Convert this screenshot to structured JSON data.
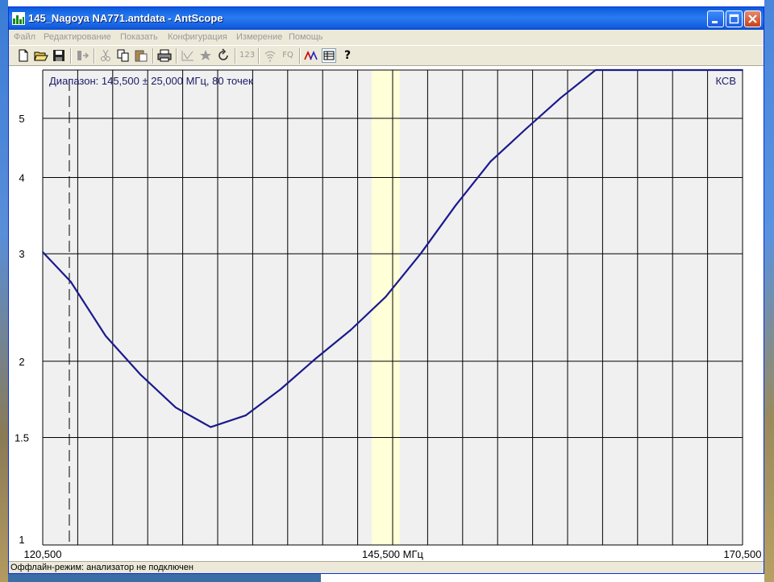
{
  "window": {
    "title": "145_Nagoya NA771.antdata - AntScope"
  },
  "menu": {
    "items": [
      "Файл",
      "Редактирование",
      "Показать",
      "Конфигурация",
      "Измерение",
      "Помощь"
    ]
  },
  "toolbar": {
    "buttons": [
      "new-file-icon",
      "open-folder-icon",
      "save-disk-icon",
      "export-icon",
      "cut-icon",
      "copy-icon",
      "paste-icon",
      "print-icon",
      "graph-icon",
      "marker-icon",
      "refresh-icon",
      "numbers-icon",
      "wireless-icon",
      "fq-icon",
      "curves-icon",
      "table-icon",
      "help-icon"
    ],
    "fq_label": "FQ",
    "numbers_label": "123",
    "help_label": "?"
  },
  "status": {
    "text": "Оффлайн-режим: анализатор не подключен"
  },
  "chart_data": {
    "type": "line",
    "info_label": "Диапазон: 145,500 ± 25,000 МГц, 80 точек",
    "ylabel": "КСВ",
    "xlim": [
      120.5,
      170.5
    ],
    "ylim": [
      1,
      6
    ],
    "x_tick_labels": [
      "120,500",
      "145,500 МГц",
      "170,500"
    ],
    "y_ticks": [
      1,
      1.5,
      2,
      3,
      4,
      5
    ],
    "y_tick_labels": [
      "1",
      "1.5",
      "2",
      "3",
      "4",
      "5"
    ],
    "highlight_band": [
      144,
      146
    ],
    "marker_x": 122.4,
    "grid": true,
    "colors": {
      "line": "#1a1a8c",
      "background": "#f0f0f0",
      "band": "#ffffd8"
    },
    "series": [
      {
        "x": [
          120.5,
          122.5,
          125,
          127.5,
          130,
          132.5,
          135,
          137.5,
          140,
          142.5,
          145,
          147.5,
          150,
          152.5,
          155,
          157.5,
          160,
          162.5,
          164.2,
          166,
          168,
          170.5
        ],
        "y": [
          3.02,
          2.7,
          2.2,
          1.9,
          1.68,
          1.56,
          1.63,
          1.8,
          2.02,
          2.25,
          2.55,
          3.0,
          3.6,
          4.25,
          4.8,
          5.4,
          6.0,
          6.0,
          6.0,
          6.0,
          6.0,
          6.0
        ]
      }
    ]
  }
}
